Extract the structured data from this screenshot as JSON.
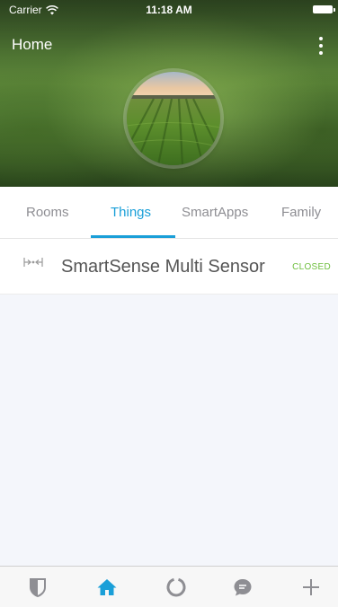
{
  "status_bar": {
    "carrier": "Carrier",
    "time": "11:18 AM"
  },
  "header": {
    "title": "Home",
    "menu_icon": "more-vertical-icon",
    "avatar": "field-landscape-photo"
  },
  "tabs": [
    {
      "label": "Rooms",
      "active": false
    },
    {
      "label": "Things",
      "active": true
    },
    {
      "label": "SmartApps",
      "active": false
    },
    {
      "label": "Family",
      "active": false
    }
  ],
  "things": [
    {
      "icon": "multi-sensor-icon",
      "name": "SmartSense Multi Sensor",
      "status": "CLOSED"
    }
  ],
  "tab_bar": [
    {
      "icon": "shield-icon",
      "active": false
    },
    {
      "icon": "home-icon",
      "active": true
    },
    {
      "icon": "activity-ring-icon",
      "active": false
    },
    {
      "icon": "chat-bubble-icon",
      "active": false
    },
    {
      "icon": "plus-icon",
      "active": false
    }
  ],
  "colors": {
    "accent": "#1a9fd8",
    "status_closed": "#6fbf3f",
    "inactive_icon": "#8e8e93"
  }
}
